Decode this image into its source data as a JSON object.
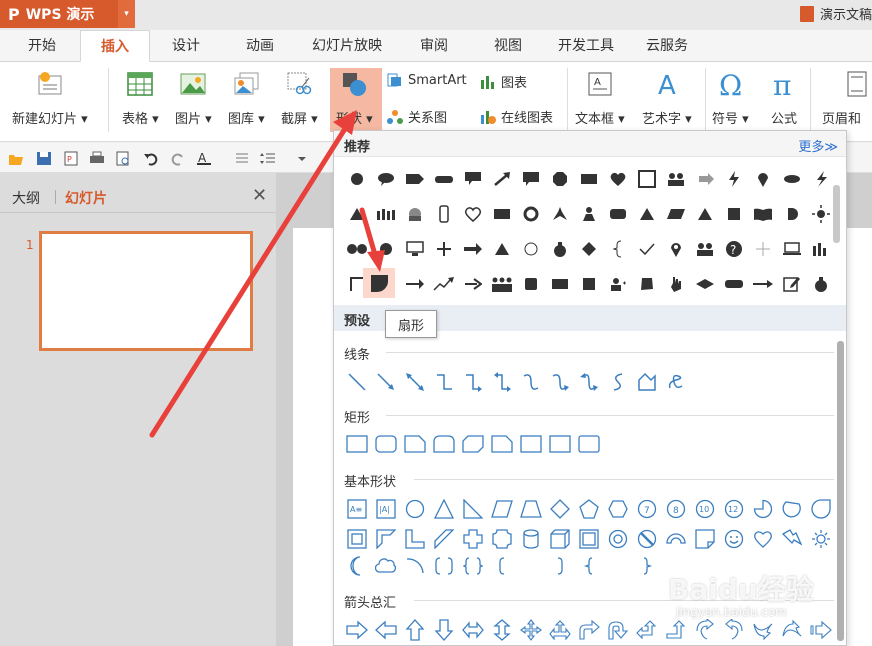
{
  "app": {
    "name": "WPS 演示",
    "logo_char": "P",
    "doc_title": "演示文稿"
  },
  "menu_tabs": [
    "开始",
    "插入",
    "设计",
    "动画",
    "幻灯片放映",
    "审阅",
    "视图",
    "开发工具",
    "云服务"
  ],
  "active_tab": "插入",
  "ribbon": {
    "new_slide": "新建幻灯片",
    "table": "表格",
    "picture": "图片",
    "gallery": "图库",
    "screenshot": "截屏",
    "shape": "形状",
    "smartart": "SmartArt",
    "chart": "图表",
    "relation": "关系图",
    "online_chart": "在线图表",
    "textbox": "文本框",
    "wordart": "艺术字",
    "symbol": "符号",
    "formula": "公式",
    "header_footer": "页眉和页"
  },
  "left_panel": {
    "tab_outline": "大纲",
    "tab_slides": "幻灯片",
    "slide_number": "1"
  },
  "shapes_menu": {
    "recommended": "推荐",
    "more": "更多≫",
    "preset": "预设",
    "tooltip": "扇形",
    "categories": {
      "lines": "线条",
      "rectangles": "矩形",
      "basic": "基本形状",
      "arrows": "箭头总汇"
    },
    "basic_labels": [
      "A≡",
      "|A|",
      "7",
      "8",
      "10",
      "12"
    ]
  },
  "watermark": {
    "main": "Baidu经验",
    "sub": "jingyan.baidu.com"
  },
  "colors": {
    "accent": "#d65a2c",
    "arrow": "#e8403a",
    "link": "#2e6fd0"
  }
}
